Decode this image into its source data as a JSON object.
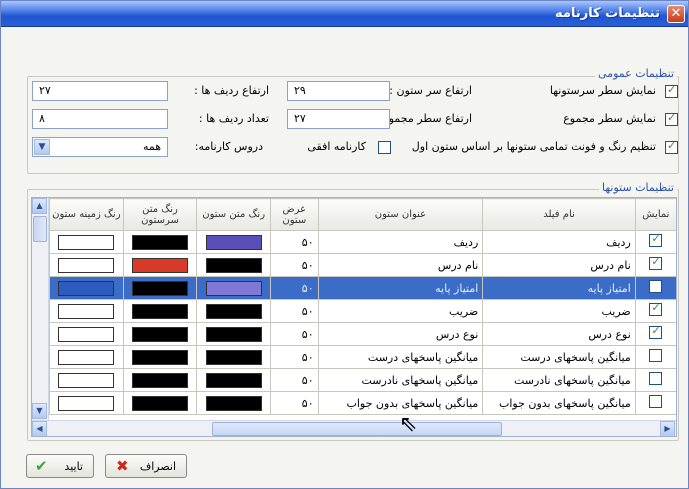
{
  "window": {
    "title": "تنظیمات کارنامه",
    "close": "✕"
  },
  "general": {
    "group_label": "تنظیمات عمومی",
    "show_header_row": "نمایش سطر سرستونها",
    "header_height_label": "ارتفاع سر ستون :",
    "header_height_value": "۲۹",
    "row_height_label": "ارتفاع ردیف ها :",
    "row_height_value": "۲۷",
    "show_sum_row": "نمایش سطر مجموع",
    "sum_height_label": "ارتفاع سطر مجموع :",
    "sum_height_value": "۲۷",
    "row_count_label": "تعداد ردیف ها :",
    "row_count_value": "۸",
    "color_font_setting": "تنظیم رنگ و فونت تمامی ستونها بر اساس ستون اول",
    "horizontal_label": "کارنامه افقی",
    "courses_label": "دروس کارنامه:",
    "courses_value": "همه"
  },
  "columns": {
    "group_label": "تنظیمات ستونها",
    "headers": {
      "show": "نمایش",
      "field": "نام فیلد",
      "title": "عنوان ستون",
      "width": "عرض ستون",
      "text_color": "رنگ متن ستون",
      "header_text_color": "رنگ متن سرستون",
      "bg_color": "رنگ زمینه ستون"
    },
    "rows": [
      {
        "show": true,
        "field": "ردیف",
        "title": "ردیف",
        "width": "۵۰",
        "text_color": "#5a4fb8",
        "header_color": "#000000",
        "bg_color": "#ffffff"
      },
      {
        "show": true,
        "field": "نام درس",
        "title": "نام درس",
        "width": "۵۰",
        "text_color": "#000000",
        "header_color": "#d83a2a",
        "bg_color": "#ffffff"
      },
      {
        "show": false,
        "field": "امتیاز پایه",
        "title": "امتیاز پایه",
        "width": "۵۰",
        "text_color": "#7f79d6",
        "header_color": "#000000",
        "bg_color": "#2d5bc0",
        "selected": true
      },
      {
        "show": true,
        "field": "ضریب",
        "title": "ضریب",
        "width": "۵۰",
        "text_color": "#000000",
        "header_color": "#000000",
        "bg_color": "#ffffff"
      },
      {
        "show": true,
        "field": "نوع درس",
        "title": "نوع درس",
        "width": "۵۰",
        "text_color": "#000000",
        "header_color": "#000000",
        "bg_color": "#ffffff"
      },
      {
        "show": false,
        "field": "میانگین پاسخهای درست",
        "title": "میانگین پاسخهای درست",
        "width": "۵۰",
        "text_color": "#000000",
        "header_color": "#000000",
        "bg_color": "#ffffff"
      },
      {
        "show": false,
        "field": "میانگین پاسخهای نادرست",
        "title": "میانگین پاسخهای نادرست",
        "width": "۵۰",
        "text_color": "#000000",
        "header_color": "#000000",
        "bg_color": "#ffffff"
      },
      {
        "show": false,
        "field": "میانگین پاسخهای بدون جواب",
        "title": "میانگین پاسخهای بدون جواب",
        "width": "۵۰",
        "text_color": "#000000",
        "header_color": "#000000",
        "bg_color": "#ffffff"
      }
    ]
  },
  "buttons": {
    "ok": "تایید",
    "cancel": "انصراف"
  },
  "icons": {
    "ok": "check-icon",
    "cancel": "x-icon",
    "dropdown": "chevron-down-icon",
    "close": "close-icon"
  },
  "colors": {
    "accent": "#2a5fd8",
    "selection": "#3a6cc8",
    "group_label": "#2a52a8"
  }
}
